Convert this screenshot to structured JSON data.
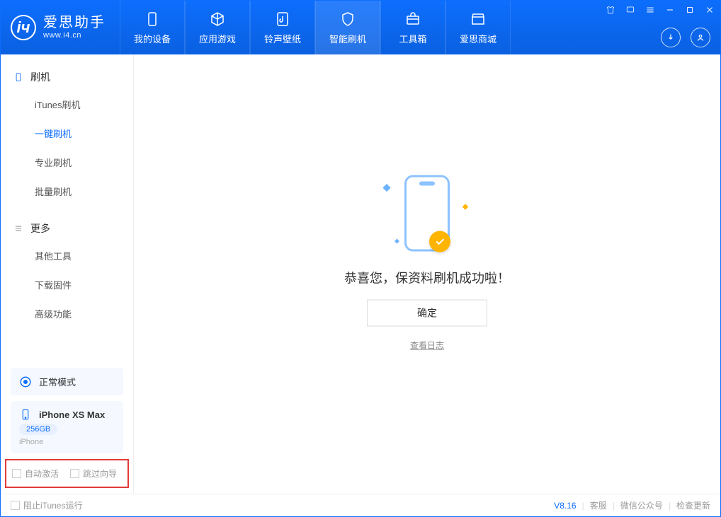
{
  "app": {
    "title": "爱思助手",
    "subtitle": "www.i4.cn"
  },
  "nav": {
    "items": [
      {
        "label": "我的设备"
      },
      {
        "label": "应用游戏"
      },
      {
        "label": "铃声壁纸"
      },
      {
        "label": "智能刷机"
      },
      {
        "label": "工具箱"
      },
      {
        "label": "爱思商城"
      }
    ]
  },
  "sidebar": {
    "group1_title": "刷机",
    "group1_items": [
      "iTunes刷机",
      "一键刷机",
      "专业刷机",
      "批量刷机"
    ],
    "group2_title": "更多",
    "group2_items": [
      "其他工具",
      "下载固件",
      "高级功能"
    ]
  },
  "mode": {
    "label": "正常模式"
  },
  "device": {
    "name": "iPhone XS Max",
    "capacity": "256GB",
    "type": "iPhone"
  },
  "options": {
    "auto_activate": "自动激活",
    "skip_guide": "跳过向导"
  },
  "main": {
    "success_msg": "恭喜您，保资料刷机成功啦！",
    "ok_btn": "确定",
    "log_link": "查看日志"
  },
  "footer": {
    "block_itunes": "阻止iTunes运行",
    "version": "V8.16",
    "support": "客服",
    "wechat": "微信公众号",
    "update": "检查更新"
  }
}
